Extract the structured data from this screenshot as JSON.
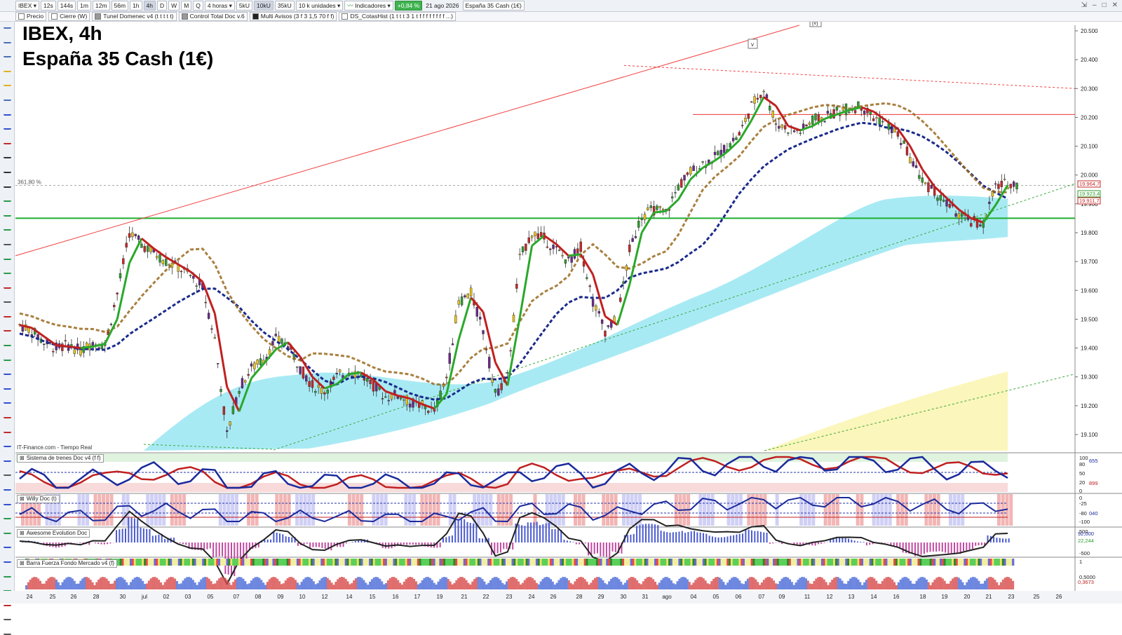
{
  "toolbar": {
    "symbol": "IBEX",
    "timeframes": [
      "12s",
      "144s",
      "1m",
      "12m",
      "56m",
      "1h",
      "4h",
      "D",
      "W",
      "M",
      "Q"
    ],
    "active_timeframe": "4h",
    "period_select": "4 horas",
    "unit_buttons": [
      "5kU",
      "10kU",
      "35kU"
    ],
    "active_unit": "10kU",
    "units_select": "10 k unidades",
    "indicators_label": "Indicadores",
    "change_badge": "+0,84 %",
    "date": "21 ago 2026",
    "instrument": "España 35 Cash (1€)"
  },
  "indicator_bar": [
    "Precio",
    "Cierre (W)",
    "Tunel Domenec v4 (t t t t t)",
    "Control Total Doc v.6",
    "Multi Avisos (3 f 3 1,5 70 f f)",
    "DS_CotasHist (1 t t t 3 1 t f f f f f f f f ...)"
  ],
  "chart_title_line1": "IBEX, 4h",
  "chart_title_line2": "España 35 Cash (1€)",
  "source_label": "IT-Finance.com - Tiempo Real",
  "fib_label": "361,80 %",
  "markers": [
    "[v]",
    "v"
  ],
  "colors": {
    "up": "#2e9e2e",
    "down": "#c62828",
    "blue_ma": "#1a2a8c",
    "brown_ma": "#9a6a1f",
    "cloud": "#9fe8f3",
    "yellow_cloud": "#fbf5b4",
    "hline_green": "#1fae2f",
    "hline_red": "#f03232"
  },
  "chart_data": {
    "type": "line",
    "title": "IBEX, 4h",
    "subtitle": "España 35 Cash (1€)",
    "y_ticks": [
      "20.500",
      "20.400",
      "20.300",
      "20.200",
      "20.100",
      "20.000",
      "19.900",
      "19.800",
      "19.700",
      "19.600",
      "19.500",
      "19.400",
      "19.300",
      "19.200",
      "19.100"
    ],
    "ylim": [
      19050,
      20550
    ],
    "x_ticks": [
      "24",
      "25",
      "26",
      "28",
      "30",
      "jul",
      "02",
      "03",
      "05",
      "07",
      "08",
      "09",
      "10",
      "12",
      "14",
      "15",
      "16",
      "17",
      "19",
      "21",
      "22",
      "23",
      "24",
      "26",
      "28",
      "29",
      "30",
      "31",
      "ago",
      "04",
      "05",
      "06",
      "07",
      "09",
      "11",
      "12",
      "13",
      "14",
      "16",
      "18",
      "19",
      "20",
      "21",
      "23",
      "25",
      "26"
    ],
    "last_price_labels": [
      "19.964,7",
      "19.923,4",
      "19.911,7"
    ],
    "horizontal_levels": [
      19850,
      20210
    ],
    "series": [
      {
        "values": [
          19480,
          19460,
          19420,
          19400,
          19410,
          19390,
          19420,
          19410,
          19590,
          19800,
          19760,
          19730,
          19700,
          19680,
          19650,
          19610,
          19430,
          19100,
          19260,
          19330,
          19360,
          19430,
          19410,
          19330,
          19270,
          19250,
          19300,
          19320,
          19310,
          19270,
          19230,
          19240,
          19210,
          19200,
          19180,
          19300,
          19560,
          19590,
          19460,
          19240,
          19300,
          19710,
          19800,
          19780,
          19740,
          19700,
          19750,
          19560,
          19460,
          19500,
          19740,
          19860,
          19880,
          19870,
          19960,
          20010,
          20040,
          20060,
          20100,
          20140,
          20240,
          20300,
          20180,
          20160,
          20150,
          20190,
          20200,
          20220,
          20230,
          20240,
          20200,
          20180,
          20140,
          20060,
          19980,
          19940,
          19900,
          19860,
          19840,
          19830,
          19960,
          19970
        ]
      }
    ]
  },
  "panels": {
    "p1": {
      "label": "Sistema de trenes Doc v4 (f f)",
      "ticks": [
        "100",
        "80",
        "50",
        "20",
        "0"
      ],
      "value_labels": [
        "655",
        "899"
      ]
    },
    "p2": {
      "label": "Willy Doc (t)",
      "ticks": [
        "0",
        "-25",
        "-80",
        "-100"
      ],
      "value_labels": [
        "040"
      ]
    },
    "p3": {
      "label": "Awesome Evolution Doc",
      "ticks": [
        "500",
        "-500"
      ],
      "value_labels": [
        "92,000",
        "22,244"
      ]
    },
    "p4": {
      "label": "Barra Fuerza Fondo Mercado v4 (f)",
      "ticks": [
        "1",
        "0,5000"
      ],
      "value_labels": [
        "0,3673"
      ]
    }
  }
}
